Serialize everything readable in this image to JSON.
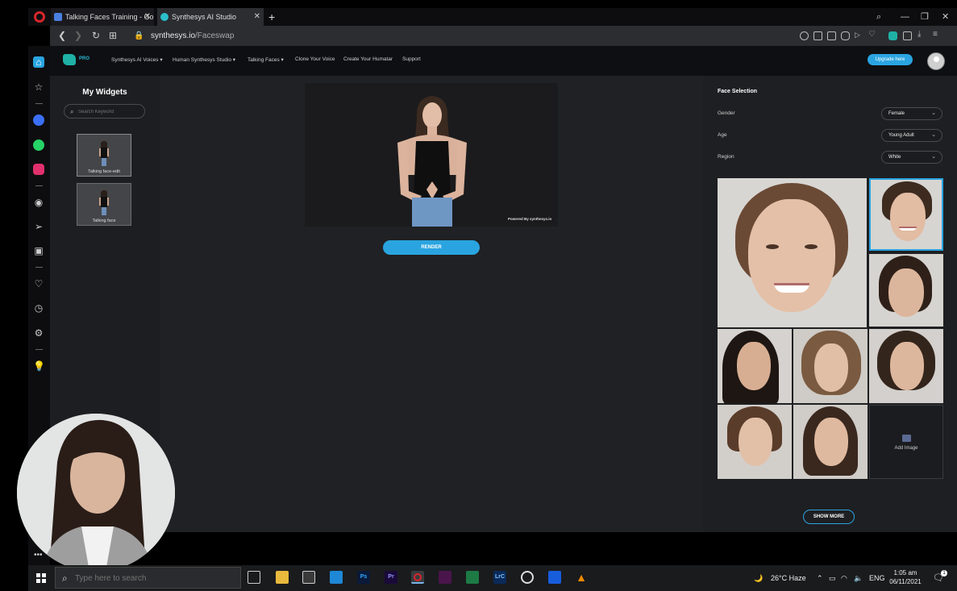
{
  "browser": {
    "tabs": [
      {
        "label": "Talking Faces Training - Go",
        "active": false
      },
      {
        "label": "Synthesys AI Studio",
        "active": true
      }
    ],
    "new_tab_glyph": "+",
    "url_host": "synthesys.io",
    "url_path": "/Faceswap"
  },
  "site": {
    "logo_badge": "PRO",
    "nav": [
      "Synthesys AI Voices",
      "Human Synthesys Studio",
      "Talking Faces",
      "Clone Your Voice",
      "Create Your Humatar",
      "Support"
    ],
    "upgrade_label": "Upgrade here"
  },
  "widgets": {
    "title": "My Widgets",
    "search_placeholder": "Search Keyword",
    "items": [
      {
        "label": "Talking face-edit"
      },
      {
        "label": "Talking face"
      }
    ]
  },
  "preview": {
    "powered_by": "Powered By synthesys.io",
    "render_label": "RENDER"
  },
  "face_selection": {
    "title": "Face Selection",
    "filters": [
      {
        "label": "Gender",
        "value": "Female"
      },
      {
        "label": "Age",
        "value": "Young Adult"
      },
      {
        "label": "Region",
        "value": "White"
      }
    ],
    "add_image_label": "Add Image",
    "show_more_label": "SHOW MORE",
    "selected_face_index": 1
  },
  "taskbar": {
    "search_placeholder": "Type here to search",
    "weather": "26°C  Haze",
    "language": "ENG",
    "time": "1:05 am",
    "date": "06/11/2021",
    "notification_count": "1"
  },
  "colors": {
    "accent": "#2aa4e0",
    "brand_teal": "#1fb1a6",
    "page_bg": "#202124",
    "opera_red": "#d7262a"
  }
}
